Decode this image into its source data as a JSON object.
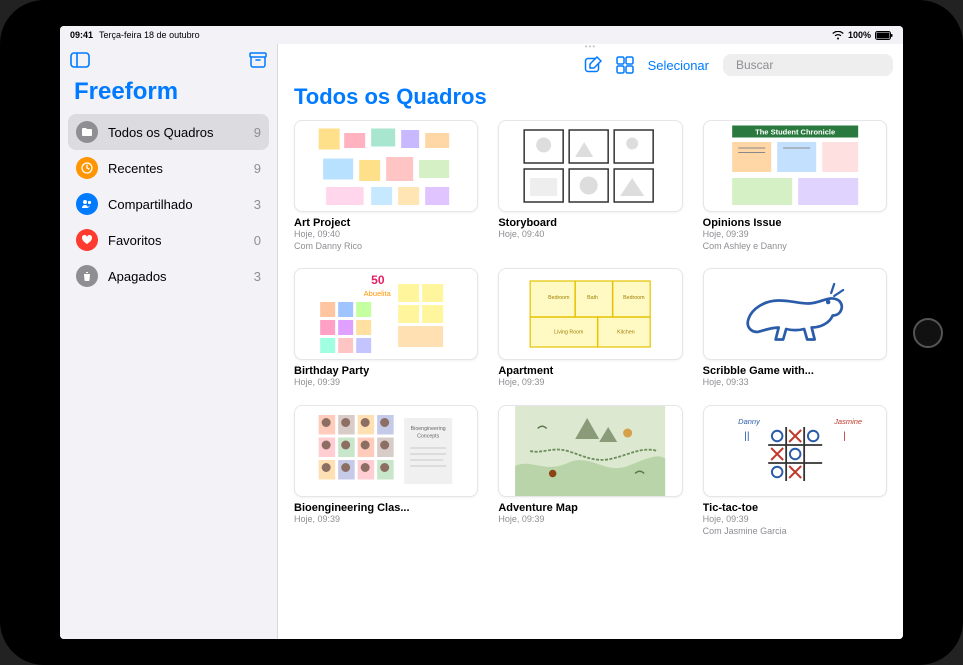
{
  "status": {
    "time": "09:41",
    "date": "Terça-feira 18 de outubro",
    "battery": "100%"
  },
  "app_title": "Freeform",
  "sidebar": {
    "items": [
      {
        "label": "Todos os Quadros",
        "count": "9",
        "icon": "folder",
        "color": "#8e8e93",
        "active": true
      },
      {
        "label": "Recentes",
        "count": "9",
        "icon": "clock",
        "color": "#ff9500",
        "active": false
      },
      {
        "label": "Compartilhado",
        "count": "3",
        "icon": "shared",
        "color": "#007aff",
        "active": false
      },
      {
        "label": "Favoritos",
        "count": "0",
        "icon": "heart",
        "color": "#ff3b30",
        "active": false
      },
      {
        "label": "Apagados",
        "count": "3",
        "icon": "trash",
        "color": "#8e8e93",
        "active": false
      }
    ]
  },
  "toolbar": {
    "select_label": "Selecionar",
    "search_placeholder": "Buscar"
  },
  "page_title": "Todos os Quadros",
  "boards": [
    {
      "name": "Art Project",
      "meta": "Hoje, 09:40",
      "shared": "Com Danny Rico"
    },
    {
      "name": "Storyboard",
      "meta": "Hoje, 09:40",
      "shared": ""
    },
    {
      "name": "Opinions Issue",
      "meta": "Hoje, 09:39",
      "shared": "Com Ashley e Danny"
    },
    {
      "name": "Birthday Party",
      "meta": "Hoje, 09:39",
      "shared": ""
    },
    {
      "name": "Apartment",
      "meta": "Hoje, 09:39",
      "shared": ""
    },
    {
      "name": "Scribble Game with...",
      "meta": "Hoje, 09:33",
      "shared": ""
    },
    {
      "name": "Bioengineering Clas...",
      "meta": "Hoje, 09:39",
      "shared": ""
    },
    {
      "name": "Adventure Map",
      "meta": "Hoje, 09:39",
      "shared": ""
    },
    {
      "name": "Tic-tac-toe",
      "meta": "Hoje, 09:39",
      "shared": "Com Jasmine Garcia"
    }
  ]
}
